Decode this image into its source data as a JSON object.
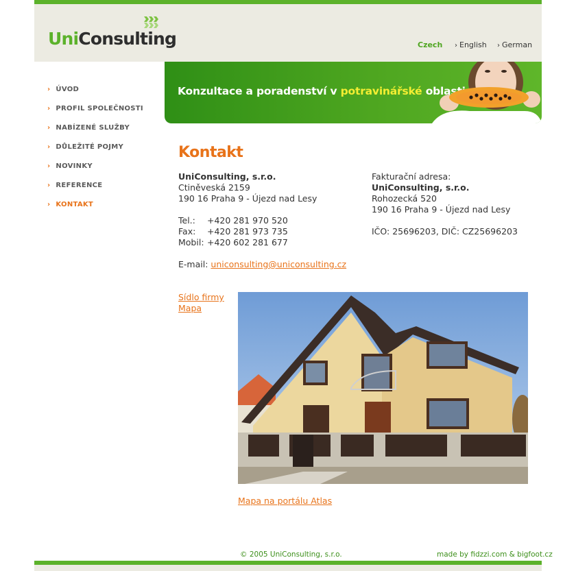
{
  "logo": {
    "uni": "Uni",
    "consulting": "Consulting"
  },
  "languages": [
    {
      "label": "Czech",
      "active": true
    },
    {
      "label": "English",
      "active": false
    },
    {
      "label": "German",
      "active": false
    }
  ],
  "nav": {
    "items": [
      {
        "label": "ÚVOD"
      },
      {
        "label": "PROFIL SPOLEČNOSTI"
      },
      {
        "label": "NABÍZENÉ SLUŽBY"
      },
      {
        "label": "DŮLEŽITÉ POJMY"
      },
      {
        "label": "NOVINKY"
      },
      {
        "label": "REFERENCE"
      },
      {
        "label": "KONTAKT",
        "active": true
      }
    ]
  },
  "banner": {
    "pre": "Konzultace a poradenství v ",
    "highlight": "potravinářské",
    "post": " oblasti"
  },
  "page_title": "Kontakt",
  "contact": {
    "company": "UniConsulting, s.r.o.",
    "street": "Ctiněveská 2159",
    "city": "190 16 Praha 9 - Újezd nad Lesy",
    "tel_label": "Tel.:",
    "tel": "+420 281 970 520",
    "fax_label": "Fax:",
    "fax": "+420 281 973 735",
    "mobil_label": "Mobil:",
    "mobil": "+420 602 281 677",
    "email_label": "E-mail:",
    "email": "uniconsulting@uniconsulting.cz"
  },
  "billing": {
    "heading": "Fakturační adresa:",
    "company": "UniConsulting, s.r.o.",
    "street": "Rohozecká 520",
    "city": "190 16 Praha 9 - Újezd nad Lesy",
    "ids": "IČO: 25696203, DIČ: CZ25696203"
  },
  "links": {
    "sidlo": "Sídlo firmy",
    "mapa": "Mapa",
    "atlas": "Mapa na portálu Atlas"
  },
  "footer": {
    "copyright": "© 2005 UniConsulting, s.r.o.",
    "made_by": "made by fidzzi.com & bigfoot.cz"
  },
  "colors": {
    "green": "#5cb22b",
    "orange": "#e8731a",
    "header_bg": "#ecebe2",
    "highlight": "#f4ee32"
  }
}
